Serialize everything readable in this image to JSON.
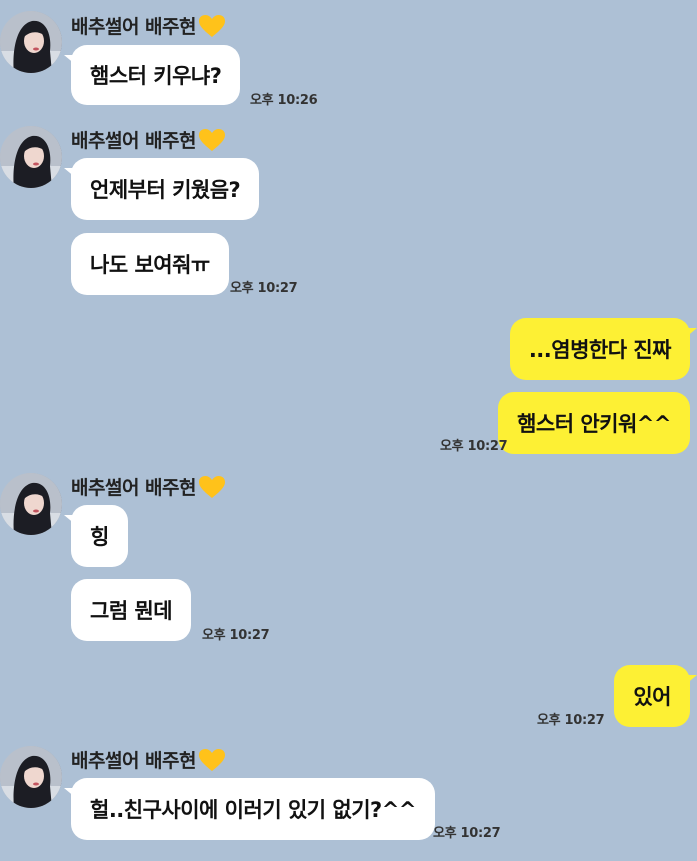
{
  "contact": {
    "name": "배추썰어 배주현",
    "heart_color": "#ffc21a"
  },
  "colors": {
    "background": "#adc0d5",
    "incoming_bubble": "#ffffff",
    "outgoing_bubble": "#fdf034"
  },
  "messages": [
    {
      "group": 1,
      "text": "햄스터 키우냐?",
      "time": "오후 10:26"
    },
    {
      "group": 2,
      "text": "언제부터 키웠음?"
    },
    {
      "group": 2,
      "text": "나도 보여줘ㅠ",
      "time": "오후 10:27"
    },
    {
      "group": 3,
      "text": "...염병한다 진짜"
    },
    {
      "group": 3,
      "text": "햄스터 안키워^^",
      "time": "오후 10:27"
    },
    {
      "group": 4,
      "text": "힝"
    },
    {
      "group": 4,
      "text": "그럼 뭔데",
      "time": "오후 10:27"
    },
    {
      "group": 5,
      "text": "있어",
      "time": "오후 10:27"
    },
    {
      "group": 6,
      "text": "헐..친구사이에 이러기 있기 없기?^^",
      "time": "오후 10:27"
    }
  ]
}
